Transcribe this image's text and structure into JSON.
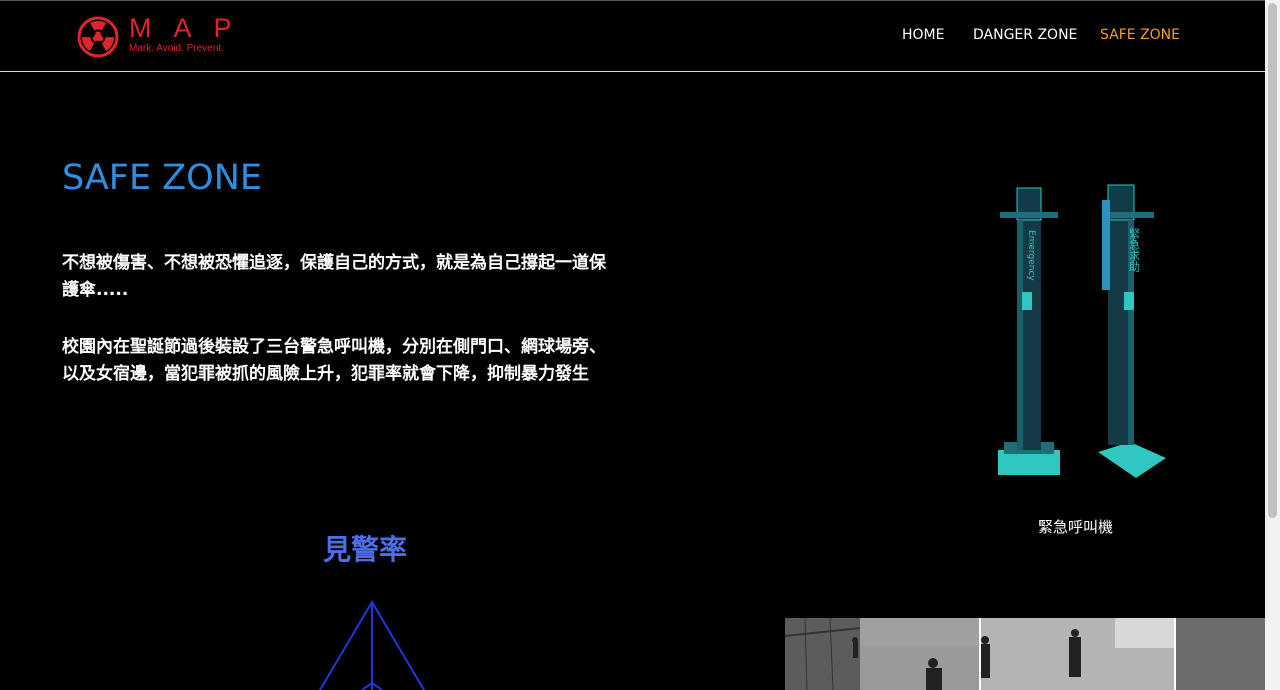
{
  "brand": {
    "title": "MAP",
    "tagline": "Mark. Avoid. Prevent.",
    "logo_icon": "radiation-icon",
    "color": "#e0242b"
  },
  "nav": {
    "items": [
      {
        "label": "HOME",
        "active": false
      },
      {
        "label": "DANGER ZONE",
        "active": false
      },
      {
        "label": "SAFE ZONE",
        "active": true
      }
    ],
    "active_color": "#f5a11c"
  },
  "main": {
    "title": "SAFE ZONE",
    "title_color": "#2e8fe0",
    "paragraphs": [
      "不想被傷害、不想被恐懼追逐，保護自己的方式，就是為自己撐起一道保護傘.....",
      "校園內在聖誕節過後裝設了三台警急呼叫機，分別在側門口、網球場旁、以及女宿邊，當犯罪被抓的風險上升，犯罪率就會下降，抑制暴力發生"
    ]
  },
  "figure": {
    "caption": "緊急呼叫機",
    "pole_labels": [
      "Emergency",
      "緊急求助"
    ]
  },
  "section2": {
    "title": "見警率",
    "title_color": "#4c6ee6"
  }
}
